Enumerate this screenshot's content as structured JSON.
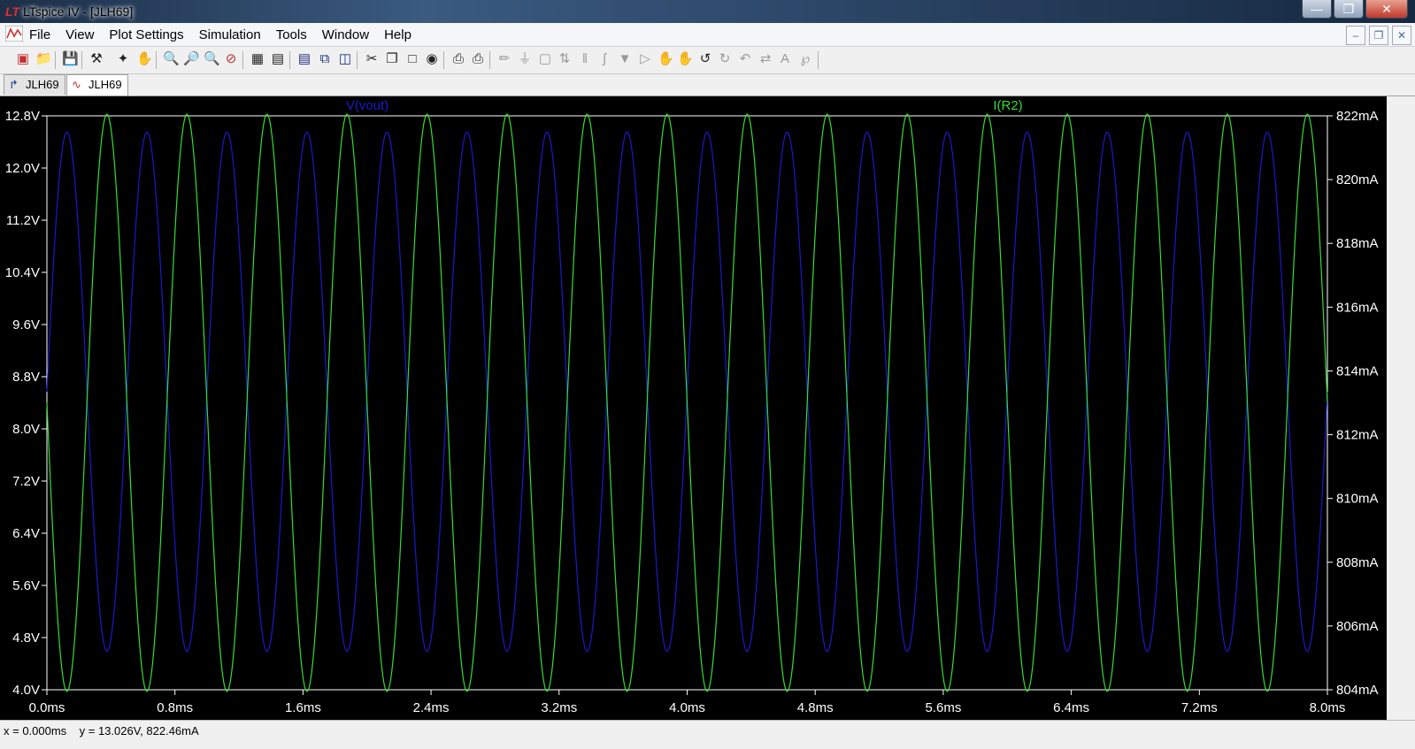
{
  "window": {
    "title": "LTspice IV - [JLH69]",
    "buttons": [
      "minimize-icon",
      "maximize-icon",
      "close-icon"
    ]
  },
  "menu": [
    "File",
    "View",
    "Plot Settings",
    "Simulation",
    "Tools",
    "Window",
    "Help"
  ],
  "toolbar_icons": [
    "new-schematic-icon",
    "open-icon",
    "save-icon",
    "control-panel-icon",
    "run-icon",
    "pause-icon",
    "zoom-in-icon",
    "zoom-area-icon",
    "zoom-out-icon",
    "zoom-cancel-icon",
    "autorange-icon",
    "fit-icon",
    "tile-horizontal-icon",
    "cascade-icon",
    "tile-vertical-icon",
    "cut-icon",
    "copy-icon",
    "paste-icon",
    "find-icon",
    "print-setup-icon",
    "print-icon",
    "wire-icon",
    "ground-icon",
    "label-icon",
    "resistor-icon",
    "capacitor-icon",
    "inductor-icon",
    "diode-icon",
    "component-icon",
    "move-icon",
    "drag-icon",
    "undo-icon",
    "redo-icon",
    "rotate-icon",
    "mirror-icon",
    "text-icon",
    "spice-directive-icon"
  ],
  "tabs": [
    {
      "label": "JLH69",
      "icon": "schematic-icon",
      "active": false
    },
    {
      "label": "JLH69",
      "icon": "waveform-icon",
      "active": true
    }
  ],
  "chart_data": {
    "type": "line",
    "x_ticks": [
      "0.0ms",
      "0.8ms",
      "1.6ms",
      "2.4ms",
      "3.2ms",
      "4.0ms",
      "4.8ms",
      "5.6ms",
      "6.4ms",
      "7.2ms",
      "8.0ms"
    ],
    "y_left_ticks": [
      "12.8V",
      "12.0V",
      "11.2V",
      "10.4V",
      "9.6V",
      "8.8V",
      "8.0V",
      "7.2V",
      "6.4V",
      "5.6V",
      "4.8V",
      "4.0V"
    ],
    "y_right_ticks": [
      "822mA",
      "820mA",
      "818mA",
      "816mA",
      "814mA",
      "812mA",
      "810mA",
      "808mA",
      "806mA",
      "804mA"
    ],
    "xlim_ms": [
      0,
      8.0
    ],
    "ylim_left_V": [
      4.0,
      12.8
    ],
    "ylim_right_mA": [
      804,
      822
    ],
    "background": "#000000",
    "axis_color": "#ffffff",
    "series": [
      {
        "name": "V(vout)",
        "axis": "left",
        "color": "#1a1acc",
        "offset_V": 8.57,
        "amplitude_V": 3.98,
        "frequency_kHz": 2.0,
        "phase_deg": 0
      },
      {
        "name": "I(R2)",
        "axis": "right",
        "color": "#33dd33",
        "offset_mA": 813.0,
        "amplitude_mA": 9.05,
        "frequency_kHz": 2.0,
        "phase_deg": 180
      }
    ]
  },
  "status": {
    "text": "x = 0.000ms    y = 13.026V, 822.46mA"
  }
}
